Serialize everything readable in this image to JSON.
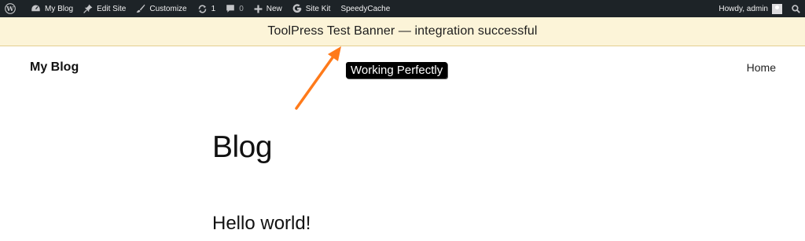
{
  "adminbar": {
    "site_name": "My Blog",
    "edit_site": "Edit Site",
    "customize": "Customize",
    "updates_count": "1",
    "comments_count": "0",
    "new_label": "New",
    "site_kit": "Site Kit",
    "speedycache": "SpeedyCache",
    "howdy": "Howdy, admin"
  },
  "banner": {
    "text": "ToolPress Test Banner — integration successful"
  },
  "header": {
    "site_title": "My Blog",
    "nav_home": "Home"
  },
  "badge": {
    "text": "Working Perfectly"
  },
  "annotation": {
    "arrow_color": "#ff7a1a"
  },
  "main": {
    "page_title": "Blog",
    "post_title": "Hello world!"
  },
  "colors": {
    "adminbar_bg": "#1d2327",
    "banner_bg": "#fcf4d8"
  }
}
